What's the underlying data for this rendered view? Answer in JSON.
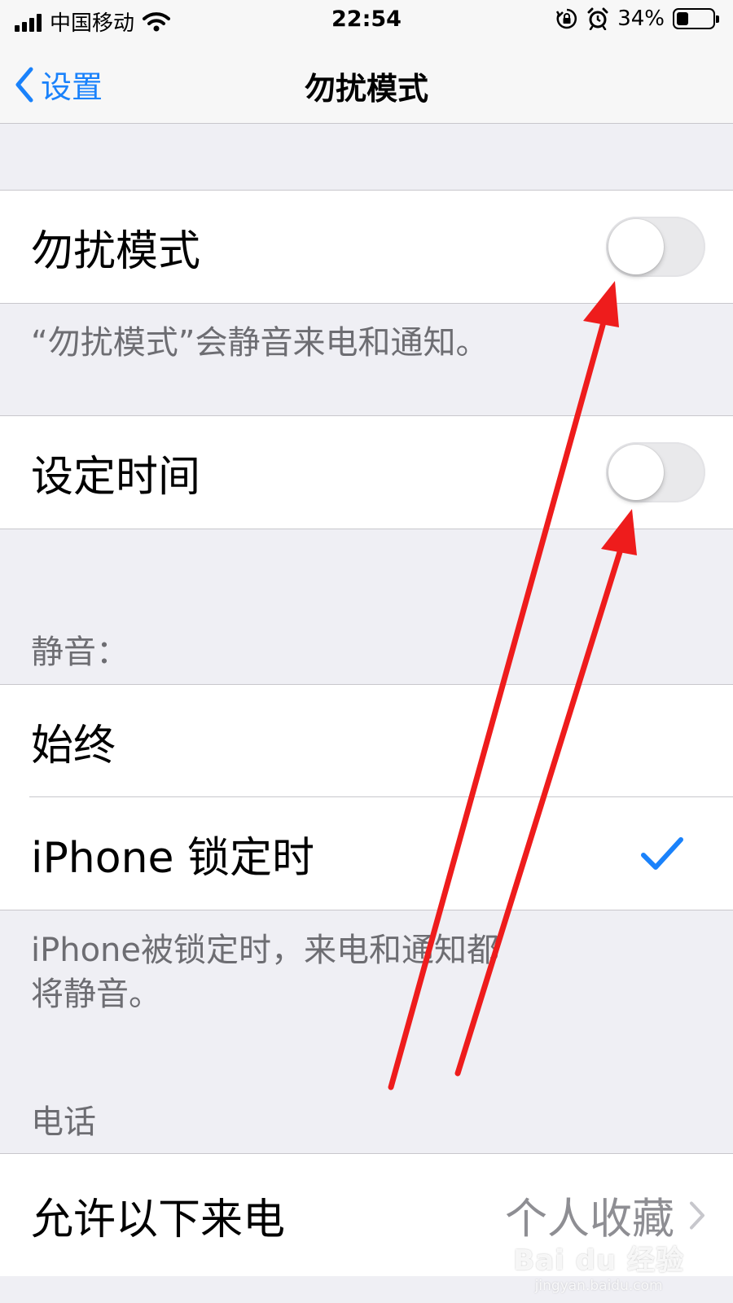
{
  "status_bar": {
    "carrier": "中国移动",
    "time": "22:54",
    "battery_percent": "34%",
    "battery_level": 0.34,
    "icons": [
      "signal-icon",
      "wifi-icon",
      "orientation-lock-icon",
      "alarm-icon",
      "battery-icon"
    ]
  },
  "nav": {
    "back_label": "设置",
    "title": "勿扰模式"
  },
  "dnd": {
    "label": "勿扰模式",
    "enabled": false,
    "footer": "“勿扰模式”会静音来电和通知。"
  },
  "scheduled": {
    "label": "设定时间",
    "enabled": false
  },
  "silence": {
    "header": "静音：",
    "options": [
      {
        "label": "始终",
        "selected": false
      },
      {
        "label": "iPhone 锁定时",
        "selected": true
      }
    ],
    "footer_line1": "iPhone被锁定时，来电和通知都",
    "footer_line2": "将静音。"
  },
  "phone": {
    "header": "电话",
    "allow_calls_label": "允许以下来电",
    "allow_calls_value": "个人收藏"
  },
  "watermark": {
    "main": "Bai du 经验",
    "sub": "jingyan.baidu.com"
  },
  "colors": {
    "accent": "#1a82fb",
    "annotation_arrow": "#ee1c1c",
    "background": "#efeff4",
    "secondary_text": "#6d6d72"
  }
}
